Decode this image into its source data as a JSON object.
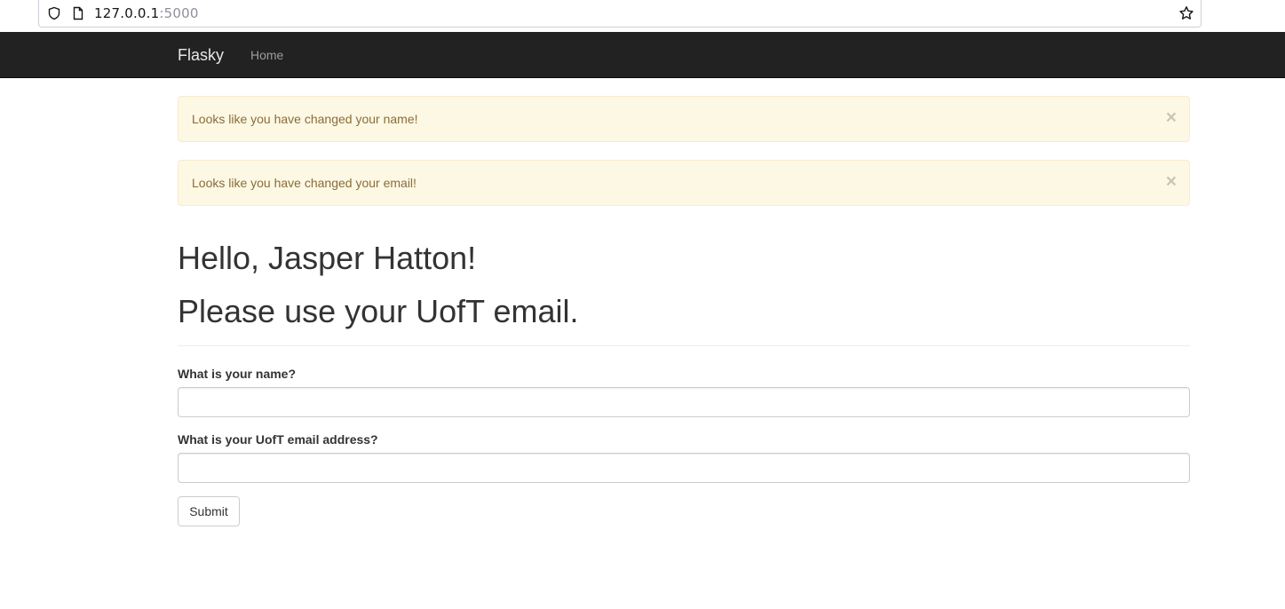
{
  "browser": {
    "url_host": "127.0.0.1",
    "url_port": ":5000"
  },
  "navbar": {
    "brand": "Flasky",
    "links": [
      "Home"
    ]
  },
  "alerts": [
    {
      "message": "Looks like you have changed your name!",
      "close": "×"
    },
    {
      "message": "Looks like you have changed your email!",
      "close": "×"
    }
  ],
  "page": {
    "greeting": "Hello, Jasper Hatton!",
    "notice": "Please use your UofT email."
  },
  "form": {
    "name_label": "What is your name?",
    "name_value": "",
    "email_label": "What is your UofT email address?",
    "email_value": "",
    "submit_label": "Submit"
  },
  "colors": {
    "navbar_bg": "#222222",
    "alert_bg": "#fcf8e3",
    "alert_border": "#faebcc",
    "alert_text": "#8a6d3b"
  },
  "icons": {
    "shield": "shield-icon",
    "page": "page-icon",
    "bookmark": "star-icon",
    "close": "close-icon"
  }
}
